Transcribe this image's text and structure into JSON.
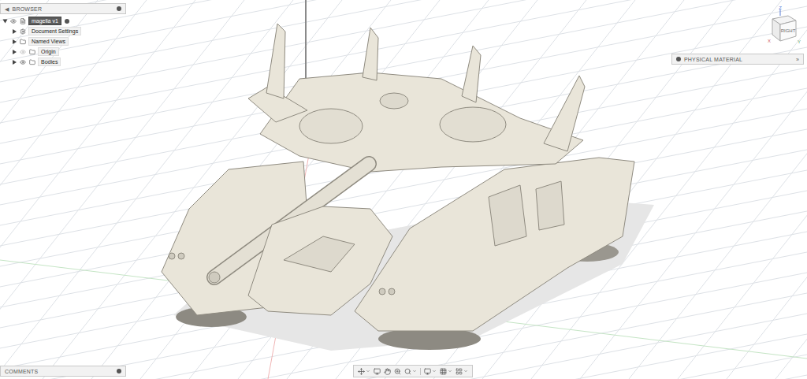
{
  "window": {
    "title": "magella v1"
  },
  "browser": {
    "title": "BROWSER",
    "collapse": "◀",
    "document": {
      "name": "magella v1",
      "expanded": true,
      "visible": true
    },
    "items": [
      {
        "label": "Document Settings",
        "kind": "gear",
        "expanded": false
      },
      {
        "label": "Named Views",
        "kind": "folder",
        "expanded": false
      },
      {
        "label": "Origin",
        "kind": "folder-eye",
        "visible": false,
        "expanded": false
      },
      {
        "label": "Bodies",
        "kind": "folder-eye",
        "visible": true,
        "expanded": false
      }
    ]
  },
  "physical_material": {
    "title": "PHYSICAL MATERIAL",
    "expand": "»"
  },
  "comments": {
    "title": "COMMENTS"
  },
  "view_cube": {
    "face": "RIGHT",
    "axes": [
      "Z",
      "X",
      "Y"
    ]
  }
}
